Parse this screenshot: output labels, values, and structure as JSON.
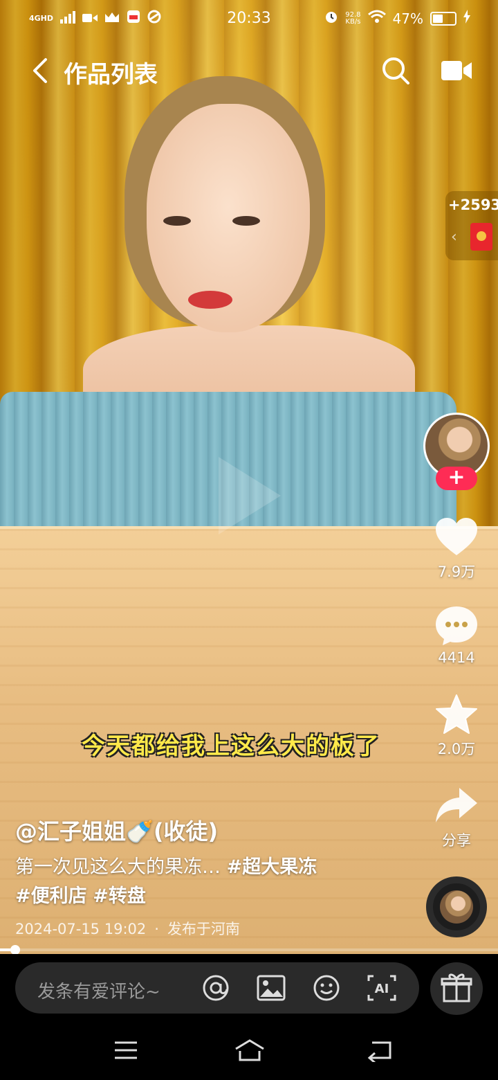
{
  "status_bar": {
    "network": "4GHD",
    "time": "20:33",
    "speed_value": "92.8",
    "speed_unit": "KB/s",
    "battery_percent": "47%",
    "battery_level": 0.47
  },
  "nav": {
    "title": "作品列表"
  },
  "red_packet": {
    "count": "+2593"
  },
  "rail": {
    "likes": "7.9万",
    "comments": "4414",
    "favorites": "2.0万",
    "share": "分享"
  },
  "video": {
    "subtitle": "今天都给我上这么大的板了",
    "author": "@汇子姐姐🍼(收徒)",
    "description": "第一次见这么大的果冻…",
    "tags": [
      "#超大果冻",
      "#便利店",
      "#转盘"
    ],
    "date": "2024-07-15 19:02",
    "meta_separator": "·",
    "location": "发布于河南",
    "progress": 0.03
  },
  "comment_bar": {
    "placeholder": "发条有爱评论~"
  },
  "colors": {
    "accent": "#fe2c55",
    "subtitle": "#ffe94a"
  }
}
